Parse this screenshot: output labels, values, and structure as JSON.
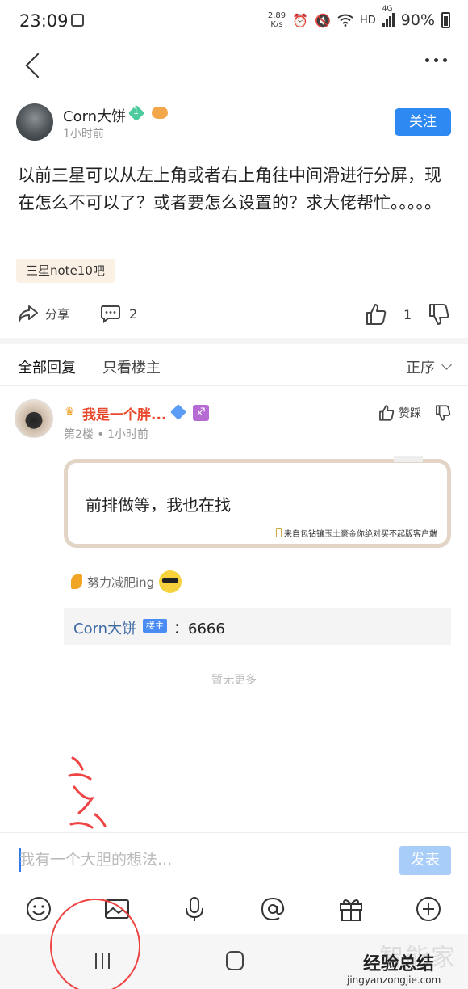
{
  "status_bar": {
    "time": "23:09",
    "speed": "2.89",
    "speed_unit": "K/s",
    "network": "HD",
    "signal": "4G",
    "battery": "90%"
  },
  "post": {
    "author": "Corn大饼",
    "level": "1",
    "time": "1小时前",
    "follow_label": "关注",
    "body": "以前三星可以从左上角或者右上角往中间滑进行分屏，现在怎么不可以了？或者要怎么设置的？求大佬帮忙。。。。。",
    "tag": "三星note10吧",
    "share_label": "分享",
    "comment_count": "2",
    "like_count": "1"
  },
  "tabs": {
    "all": "全部回复",
    "op_only": "只看楼主",
    "sort": "正序"
  },
  "reply": {
    "name": "我是一个胖...",
    "zodiac": "♐",
    "floor": "第2楼",
    "time": "1小时前",
    "like_label": "赞踩",
    "bubble_text": "前排做等，我也在找",
    "source": "来自包钻镶玉土豪金你绝对买不起版客户端",
    "signature": "努力减肥ing",
    "sub_author": "Corn大饼",
    "op_badge": "楼主",
    "sub_text": "：6666"
  },
  "no_more": "暂无更多",
  "composer": {
    "placeholder": "我有一个大胆的想法...",
    "send_label": "发表"
  },
  "watermark": {
    "line1": "智能家",
    "line2": "经验总结",
    "url": "jingyanzongjie.com"
  },
  "colors": {
    "accent": "#2f89f3",
    "reply_name": "#e8482c",
    "link": "#3d69a3",
    "annotation": "#e44444"
  }
}
